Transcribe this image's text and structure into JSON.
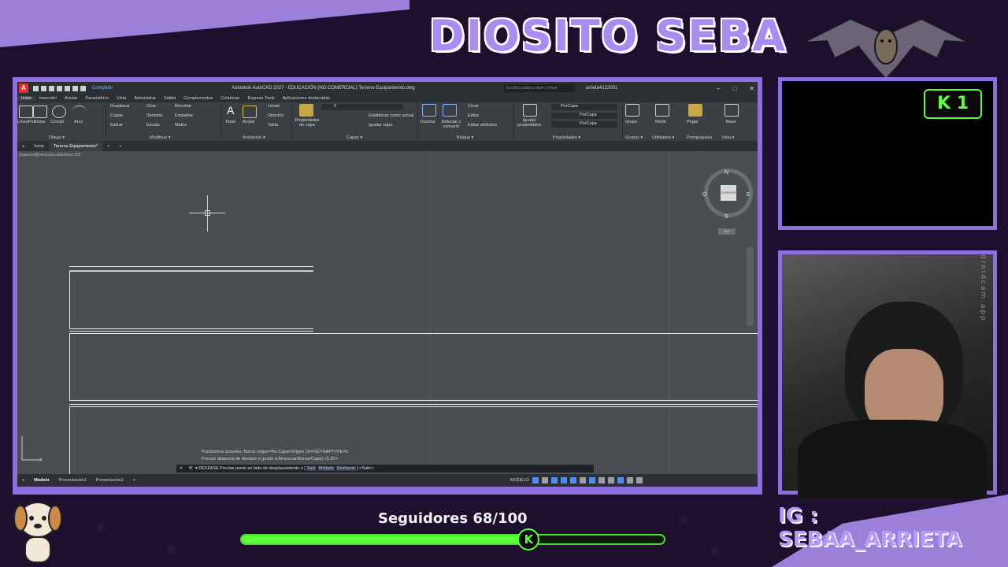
{
  "overlay": {
    "channel_title": "DIOSITO SEBA",
    "followers_label": "Seguidores 68/100",
    "followers_progress": 0.68,
    "instagram": "IG : SEBAA_ARRIETA",
    "kick_badge": "K 1",
    "kick_knob": "K",
    "webcam_watermark": "droidcam.app"
  },
  "acad": {
    "titlebar": {
      "logo": "A",
      "share": "Compartir",
      "title": "Autodesk AutoCAD 2027 - EDUCACIÓN (NO COMERCIAL)   Terreno Equipamiento.dwg",
      "search_placeholder": "Escriba palabra clave o frase",
      "user": "arrieta4122001",
      "min": "–",
      "max": "□",
      "close": "✕"
    },
    "menu_tabs": [
      "Inicio",
      "Inserción",
      "Anotar",
      "Paramétrico",
      "Vista",
      "Administrar",
      "Salida",
      "Complementos",
      "Colaborar",
      "Express Tools",
      "Aplicaciones destacadas"
    ],
    "ribbon": {
      "draw": [
        "Línea",
        "Polilínea",
        "Círculo",
        "Arco"
      ],
      "modify": [
        "Desplazar",
        "Girar",
        "Recortar",
        "Copiar",
        "Simetría",
        "Empalme",
        "Estirar",
        "Escala",
        "Matriz"
      ],
      "annotation": [
        "Texto",
        "Acotar",
        "Lineal",
        "Directriz",
        "Tabla"
      ],
      "layers": [
        "Propiedades de capa",
        "Establecer como actual",
        "Igualar capa"
      ],
      "layer_value": "0",
      "block": [
        "Insertar",
        "Detectar y convertir",
        "Crear",
        "Editar",
        "Editar atributos"
      ],
      "properties": [
        "Igualar propiedades",
        "PorCapa",
        "PorCapa",
        "PorCapa"
      ],
      "groups": [
        "Grupo"
      ],
      "utilities": [
        "Medir"
      ],
      "clipboard": [
        "Pegar"
      ],
      "view": [
        "Base"
      ],
      "panels": [
        "Dibujo ▾",
        "Modificar ▾",
        "Anotación ▾",
        "Capas ▾",
        "Bloque ▾",
        "Propiedades ▾",
        "Grupos ▾",
        "Utilidades ▾",
        "Portapapeles",
        "Vista ▾"
      ]
    },
    "doc_tabs": [
      "Inicio",
      "Terreno Equipamiento*",
      "×",
      "+"
    ],
    "viewport_label": "[Superior][Estructura alámbrica 2D]",
    "viewcube": {
      "n": "N",
      "s": "S",
      "e": "E",
      "w": "O",
      "face": "SUPERIOR",
      "wcs": "SCP"
    },
    "command_history": [
      "Parámetros actuales: Borrar origen=No  Capa=Origen  OFFSETGAPTYPE=0",
      "Precise distancia de desfase o [punto a Atravesar/Borrar/Capa] <0.20>:"
    ],
    "command_line": {
      "prefix": "▾ DESFASE Precise punto en lado de desplazamiento o [",
      "opt1": "Salir",
      "opt2": "Múltiple",
      "opt3": "Deshacer",
      "suffix": "] <Salir>:"
    },
    "status": {
      "tabs": [
        "Modelo",
        "Presentación1",
        "Presentación2",
        "+"
      ],
      "model": "MODELO"
    }
  }
}
